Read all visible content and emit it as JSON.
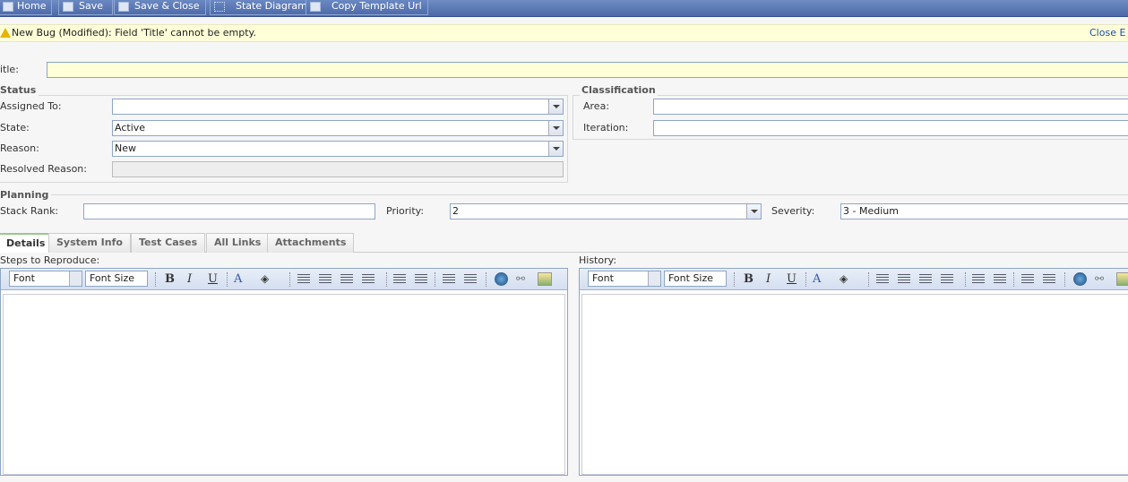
{
  "toolbar": {
    "home": "Home",
    "save": "Save",
    "save_close": "Save & Close",
    "state_diagram": "State Diagram",
    "copy_url": "Copy Template Url"
  },
  "info": {
    "message": "New Bug (Modified): Field 'Title' cannot be empty.",
    "close": "Close E"
  },
  "title": {
    "label": "itle:",
    "value": ""
  },
  "status": {
    "legend": "Status",
    "assigned_to": {
      "label": "Assigned To:",
      "value": ""
    },
    "state": {
      "label": "State:",
      "value": "Active"
    },
    "reason": {
      "label": "Reason:",
      "value": "New"
    },
    "resolved_reason": {
      "label": "Resolved Reason:",
      "value": ""
    }
  },
  "classification": {
    "legend": "Classification",
    "area": {
      "label": "Area:",
      "value": ""
    },
    "iteration": {
      "label": "Iteration:",
      "value": ""
    }
  },
  "planning": {
    "legend": "Planning",
    "stack_rank": {
      "label": "Stack Rank:",
      "value": ""
    },
    "priority": {
      "label": "Priority:",
      "value": "2"
    },
    "severity": {
      "label": "Severity:",
      "value": "3 - Medium"
    }
  },
  "tabs": [
    "Details",
    "System Info",
    "Test Cases",
    "All Links",
    "Attachments"
  ],
  "editors": {
    "steps_label": "Steps to Reproduce:",
    "history_label": "History:",
    "font": "Font",
    "font_size": "Font Size",
    "bold": "B",
    "italic": "I",
    "underline": "U",
    "font_color": "A"
  }
}
